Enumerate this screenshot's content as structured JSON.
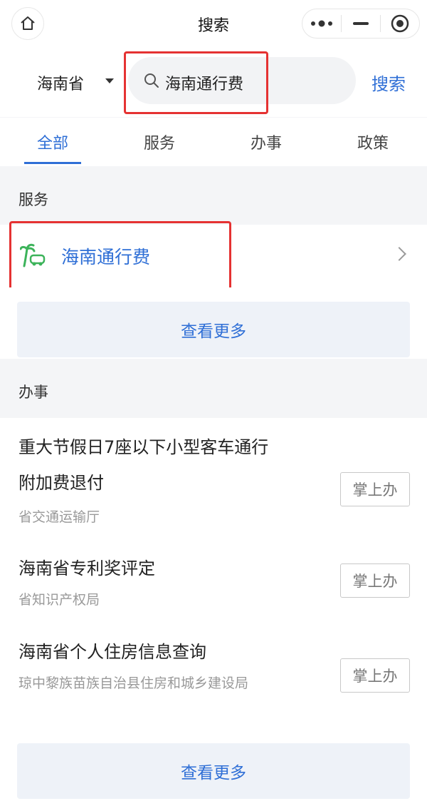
{
  "titlebar": {
    "title": "搜索",
    "home_icon": "home-icon",
    "more_icon": "more-dots-icon",
    "minimize_icon": "minimize-icon",
    "close_icon": "target-circle-icon"
  },
  "search": {
    "region": "海南省",
    "query": "海南通行费",
    "button_label": "搜索"
  },
  "tabs": [
    {
      "label": "全部",
      "active": true
    },
    {
      "label": "服务",
      "active": false
    },
    {
      "label": "办事",
      "active": false
    },
    {
      "label": "政策",
      "active": false
    }
  ],
  "services": {
    "section_title": "服务",
    "items": [
      {
        "name": "海南通行费",
        "icon": "palm-car-logo-icon"
      }
    ],
    "more_label": "查看更多"
  },
  "work": {
    "section_title": "办事",
    "items": [
      {
        "title": "重大节假日7座以下小型客车通行附加费退付",
        "dept": "省交通运输厅",
        "action": "掌上办"
      },
      {
        "title": "海南省专利奖评定",
        "dept": "省知识产权局",
        "action": "掌上办"
      },
      {
        "title": "海南省个人住房信息查询",
        "dept": "琼中黎族苗族自治县住房和城乡建设局",
        "action": "掌上办"
      }
    ],
    "more_label": "查看更多"
  },
  "colors": {
    "accent": "#2f6fd6",
    "highlight_red": "#e53232",
    "logo_green": "#3cb35a"
  }
}
